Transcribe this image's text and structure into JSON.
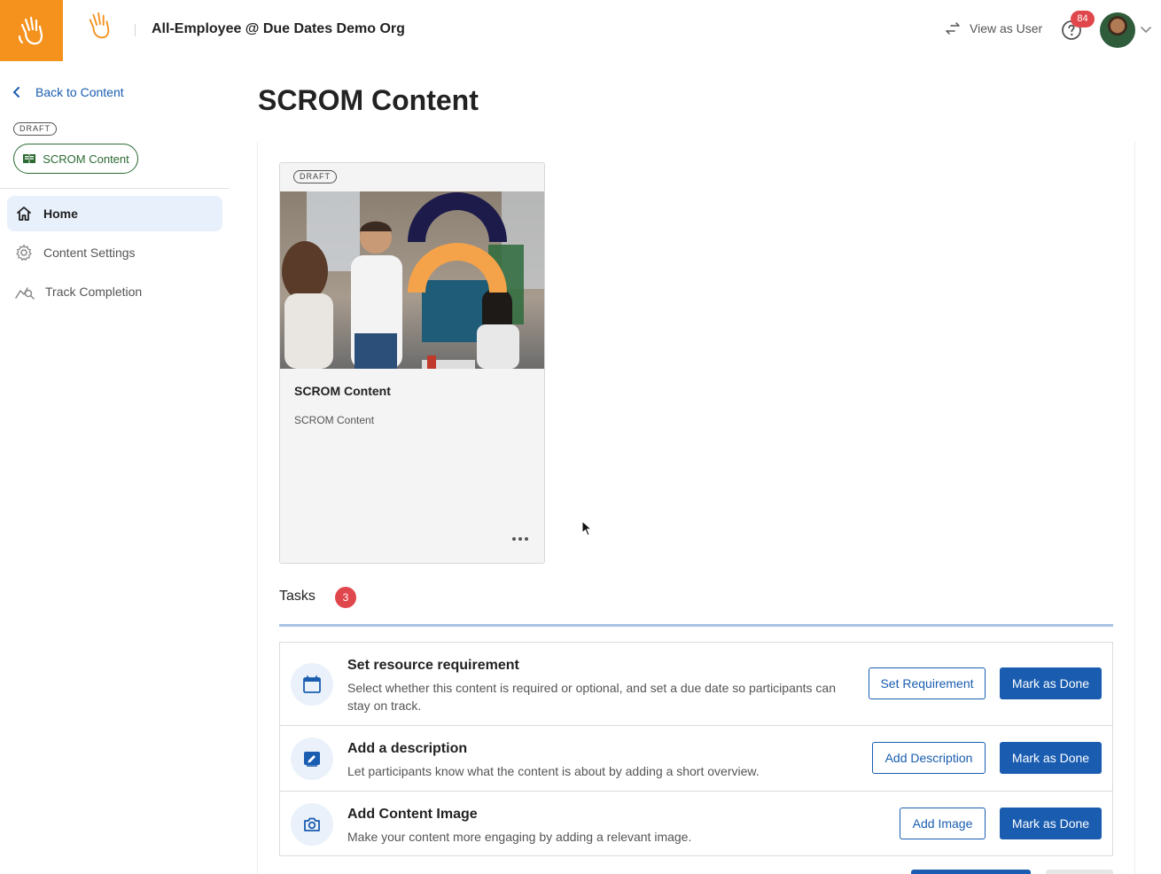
{
  "header": {
    "org_title": "All-Employee @ Due Dates Demo Org",
    "view_as_user": "View as User",
    "help_badge_count": "84",
    "brand_color": "#f5921e"
  },
  "sidebar": {
    "back_label": "Back to Content",
    "status_badge": "DRAFT",
    "content_pill": "SCROM Content",
    "nav": [
      {
        "label": "Home",
        "icon": "home-icon",
        "active": true
      },
      {
        "label": "Content Settings",
        "icon": "gear-icon",
        "active": false
      },
      {
        "label": "Track Completion",
        "icon": "chart-search-icon",
        "active": false
      }
    ]
  },
  "main": {
    "page_title": "SCROM Content",
    "card": {
      "status_badge": "DRAFT",
      "title": "SCROM Content",
      "subtitle": "SCROM Content"
    },
    "tasks": {
      "label": "Tasks",
      "count": "3",
      "items": [
        {
          "title": "Set resource requirement",
          "description": "Select whether this content is required or optional, and set a due date so participants can stay on track.",
          "action_label": "Set Requirement",
          "done_label": "Mark as Done",
          "icon": "calendar-icon"
        },
        {
          "title": "Add a description",
          "description": "Let participants know what the content is about by adding a short overview.",
          "action_label": "Add Description",
          "done_label": "Mark as Done",
          "icon": "edit-description-icon"
        },
        {
          "title": "Add Content Image",
          "description": "Make your content more engaging by adding a relevant image.",
          "action_label": "Add Image",
          "done_label": "Mark as Done",
          "icon": "camera-icon"
        }
      ]
    }
  },
  "colors": {
    "primary": "#1a5db0",
    "badge": "#e0474c",
    "active_nav": "#e8f0fb"
  }
}
